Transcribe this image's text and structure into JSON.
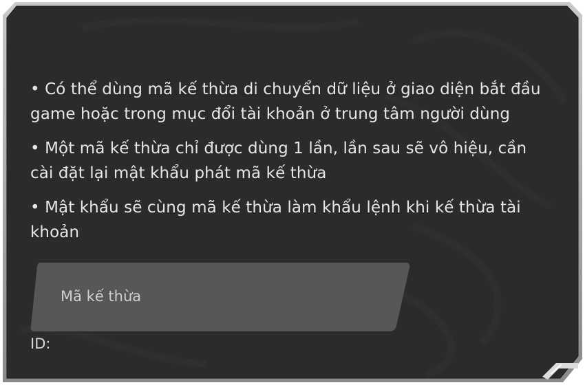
{
  "info": {
    "items": [
      "• Có thể dùng mã kế thừa di chuyển dữ liệu ở giao diện bắt đầu game hoặc trong mục đổi tài khoản ở trung tâm người dùng",
      "• Một mã kế thừa chỉ được dùng 1 lần, lần sau sẽ vô hiệu, cần cài đặt lại mật khẩu phát mã kế thừa",
      "• Mật khẩu sẽ cùng mã kế thừa làm khẩu lệnh khi kế thừa tài khoản"
    ]
  },
  "input": {
    "placeholder": "Mã kế thừa"
  },
  "id_label": "ID:",
  "colors": {
    "panel": "#2a2a2a",
    "border": "#9a9a9a",
    "input_bg": "#555555",
    "text": "#e6e6e6"
  }
}
